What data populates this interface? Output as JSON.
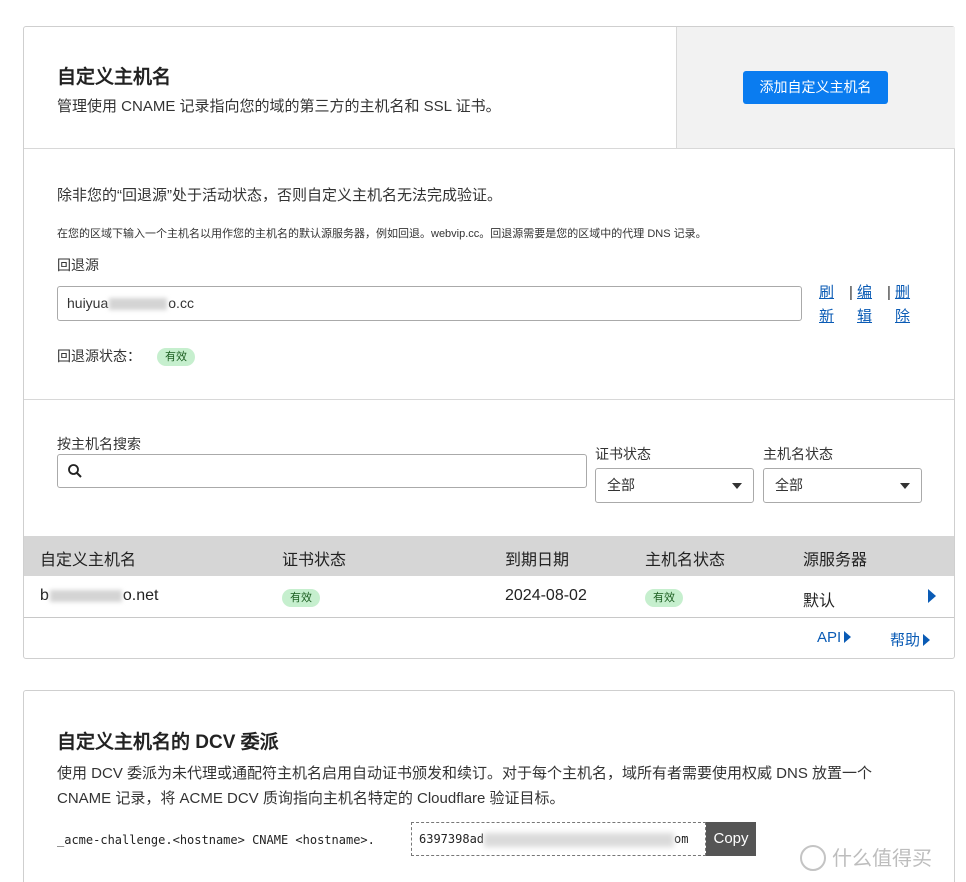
{
  "header": {
    "title": "自定义主机名",
    "subtitle": "管理使用 CNAME 记录指向您的域的第三方的主机名和 SSL 证书。",
    "add_button": "添加自定义主机名"
  },
  "fallback": {
    "warning": "除非您的“回退源”处于活动状态，否则自定义主机名无法完成验证。",
    "help": "在您的区域下输入一个主机名以用作您的主机名的默认源服务器，例如回退。webvip.cc。回退源需要是您的区域中的代理 DNS 记录。",
    "label": "回退源",
    "value_prefix": "huiyua",
    "value_suffix": "o.cc",
    "actions": {
      "refresh_1": "刷",
      "refresh_2": "新",
      "edit_1": "编",
      "edit_2": "辑",
      "delete_1": "删",
      "delete_2": "除"
    },
    "status_label": "回退源状态：",
    "status_value": "有效"
  },
  "filters": {
    "search_label": "按主机名搜索",
    "search_placeholder": "",
    "cert_status_label": "证书状态",
    "cert_status_value": "全部",
    "host_status_label": "主机名状态",
    "host_status_value": "全部"
  },
  "table": {
    "columns": [
      "自定义主机名",
      "证书状态",
      "到期日期",
      "主机名状态",
      "源服务器"
    ],
    "rows": [
      {
        "hostname_prefix": "b",
        "hostname_suffix": "o.net",
        "cert_status": "有效",
        "expiry": "2024-08-02",
        "host_status": "有效",
        "origin": "默认"
      }
    ]
  },
  "footer_links": {
    "api": "API",
    "help": "帮助"
  },
  "dcv": {
    "title": "自定义主机名的 DCV 委派",
    "desc": "使用 DCV 委派为未代理或通配符主机名启用自动证书颁发和续订。对于每个主机名，域所有者需要使用权威 DNS 放置一个 CNAME 记录，将 ACME DCV 质询指向主机名特定的 Cloudflare 验证目标。",
    "cname_line": "_acme-challenge.<hostname> CNAME <hostname>.",
    "target_prefix": "6397398ad",
    "target_suffix": "om",
    "copy_label": "Copy"
  },
  "watermark": {
    "text": "什么值得买"
  },
  "colors": {
    "primary": "#0a7cf0",
    "link": "#0a5bb5",
    "badge_bg": "#c6efce",
    "table_header": "#d6d6d6"
  }
}
